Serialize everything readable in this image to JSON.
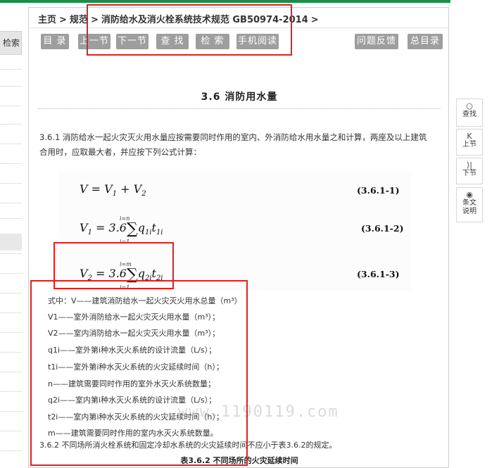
{
  "sidebar": {
    "search_label": "检索"
  },
  "breadcrumb": {
    "items": [
      "主页",
      "规范",
      "消防给水及消火栓系统技术规范 GB50974-2014"
    ],
    "separator": ">"
  },
  "toolbar": {
    "buttons": [
      "目 录",
      "上一节",
      "下一节",
      "查 找",
      "检 索",
      "手机阅读"
    ],
    "right_buttons": [
      "问题反馈",
      "总目录"
    ]
  },
  "section": {
    "title": "3.6  消防用水量",
    "p361": "3.6.1 消防给水一起火灾灭火用水量应按需要同时作用的室内、外消防给水用水量之和计算，两座及以上建筑合用时，应取最大者，并应按下列公式计算：",
    "formulas": [
      {
        "lhs": "V = V",
        "num": "(3.6.1-1)"
      },
      {
        "lhs": "V",
        "num": "(3.6.1-2)"
      },
      {
        "lhs": "V",
        "num": "(3.6.1-3)"
      }
    ],
    "definitions": [
      "式中：V——建筑消防给水一起火灾灭火用水总量（m³）",
      "V1——室外消防给水一起火灾灭火用水量（m³）；",
      "V2——室内消防给水一起火灾灭火用水量（m³）；",
      "q1i——室外第i种水灭火系统的设计流量（L/s）；",
      "t1i——室外第i种水灭火系统的火灾延续时间（h）；",
      "n——建筑需要同时作用的室外水灭火系统数量；",
      "q2i——室内第i种水灭火系统的设计流量（L/s）；",
      "t2i——室内第i种水灭火系统的火灾延续时间（h）；",
      "m——建筑需要同时作用的室内水灭火系统数量。"
    ],
    "p362": "3.6.2 不同场所消火栓系统和固定冷却水系统的火灾延续时间不应小于表3.6.2的规定。",
    "table_caption": "表3.6.2   不同场所的火灾延续时间"
  },
  "watermark": "www.1190119.com",
  "right_toolbar": [
    {
      "icon": "search-icon",
      "glyph": "○",
      "label": "查找"
    },
    {
      "icon": "prev-section-icon",
      "glyph": "K",
      "label": "上节"
    },
    {
      "icon": "next-section-icon",
      "glyph": "⟩|",
      "label": "下节"
    },
    {
      "icon": "eye-icon",
      "glyph": "◉",
      "label": "条文说明"
    }
  ],
  "colors": {
    "button_bg": "#9e9e9e",
    "annotation_red": "#e02020",
    "accent_green": "#1f8a4c"
  }
}
